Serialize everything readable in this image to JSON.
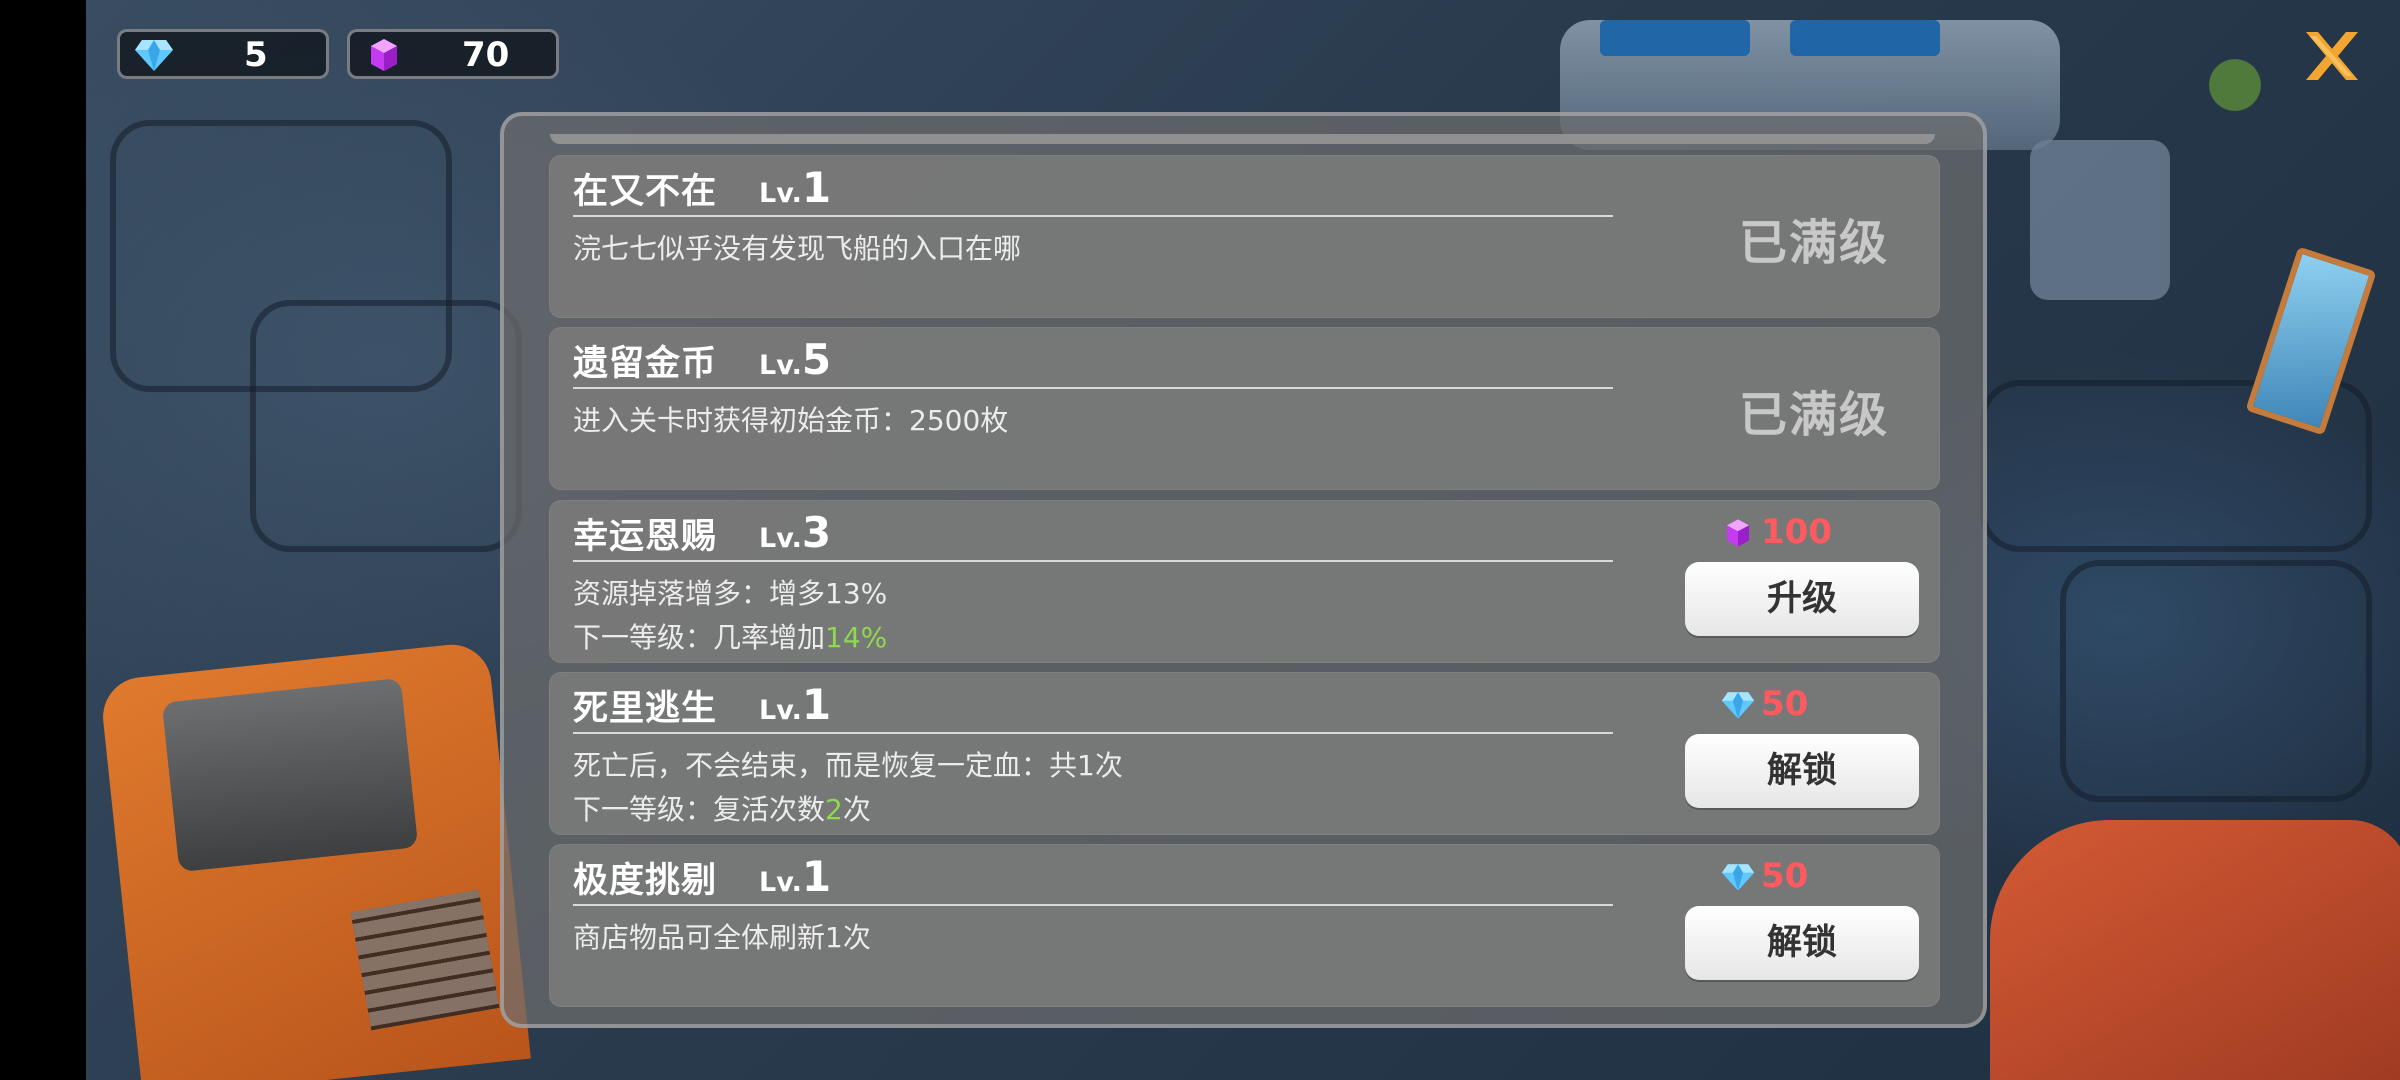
{
  "currencies": {
    "diamond": {
      "icon": "diamond-icon",
      "value": "5"
    },
    "gem": {
      "icon": "purple-gem-icon",
      "value": "70"
    }
  },
  "close_icon": "close-x-icon",
  "colors": {
    "cost_red": "#ff5a5f",
    "highlight_green": "#8fd84f",
    "close_orange": "#f3a531"
  },
  "skills": [
    {
      "name": "在又不在",
      "lv_prefix": "Lv.",
      "level": "1",
      "desc1": "浣七七似乎没有发现飞船的入口在哪",
      "state_label": "已满级"
    },
    {
      "name": "遗留金币",
      "lv_prefix": "Lv.",
      "level": "5",
      "desc1": "进入关卡时获得初始金币：2500枚",
      "state_label": "已满级"
    },
    {
      "name": "幸运恩赐",
      "lv_prefix": "Lv.",
      "level": "3",
      "desc1": "资源掉落增多：增多13%",
      "desc2_prefix": "下一等级：几率增加",
      "desc2_highlight": "14%",
      "desc2_suffix": "",
      "cost_icon": "purple-gem-icon",
      "cost": "100",
      "button_label": "升级"
    },
    {
      "name": "死里逃生",
      "lv_prefix": "Lv.",
      "level": "1",
      "desc1": "死亡后，不会结束，而是恢复一定血：共1次",
      "desc2_prefix": "下一等级：复活次数",
      "desc2_highlight": "2",
      "desc2_suffix": "次",
      "cost_icon": "diamond-icon",
      "cost": "50",
      "button_label": "解锁"
    },
    {
      "name": "极度挑剔",
      "lv_prefix": "Lv.",
      "level": "1",
      "desc1": "商店物品可全体刷新1次",
      "cost_icon": "diamond-icon",
      "cost": "50",
      "button_label": "解锁"
    }
  ]
}
